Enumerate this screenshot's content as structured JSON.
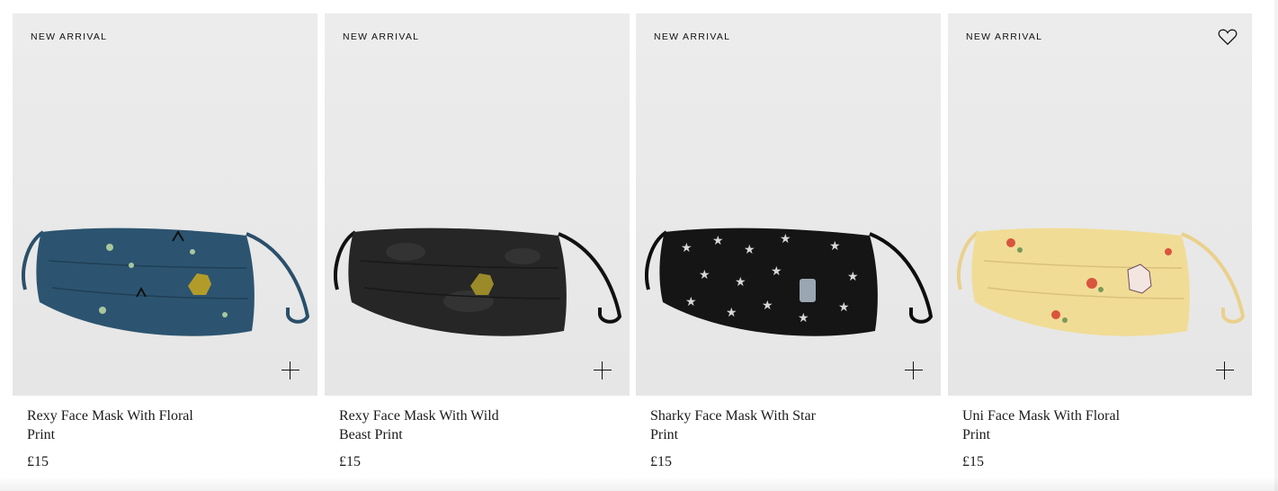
{
  "products": [
    {
      "badge": "NEW ARRIVAL",
      "name": "Rexy Face Mask With Floral Print",
      "price": "£15",
      "mask_color": "#2c5470",
      "strap_color": "#2a4f6a",
      "pattern": "floral-dino",
      "wishlist_visible": false
    },
    {
      "badge": "NEW ARRIVAL",
      "name": "Rexy Face Mask With Wild Beast Print",
      "price": "£15",
      "mask_color": "#262626",
      "strap_color": "#111111",
      "pattern": "camo-dino",
      "wishlist_visible": false
    },
    {
      "badge": "NEW ARRIVAL",
      "name": "Sharky Face Mask With Star Print",
      "price": "£15",
      "mask_color": "#151515",
      "strap_color": "#0e0e0e",
      "pattern": "stars-shark",
      "wishlist_visible": false
    },
    {
      "badge": "NEW ARRIVAL",
      "name": "Uni Face Mask With Floral Print",
      "price": "£15",
      "mask_color": "#f1dc96",
      "strap_color": "#ead08a",
      "pattern": "floral-unicorn",
      "wishlist_visible": true
    }
  ],
  "icons": {
    "wishlist": "heart-outline-icon",
    "quick_add": "plus-icon"
  }
}
